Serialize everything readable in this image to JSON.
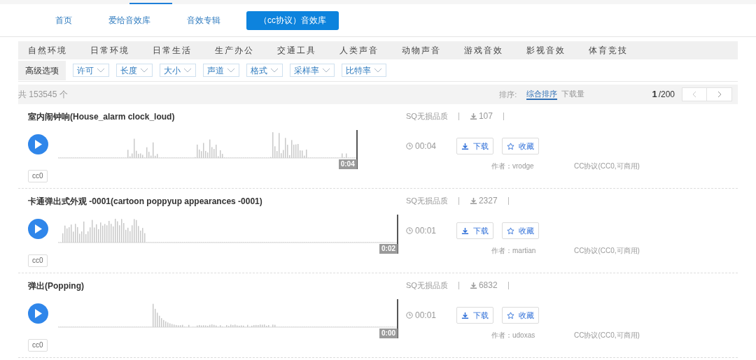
{
  "nav": [
    {
      "label": "首页",
      "selected": false
    },
    {
      "label": "爱给音效库",
      "selected": false
    },
    {
      "label": "音效专辑",
      "selected": false
    },
    {
      "label": "（cc协议）音效库",
      "selected": true
    }
  ],
  "categories": [
    "自然环境",
    "日常环境",
    "日常生活",
    "生产办公",
    "交通工具",
    "人类声音",
    "动物声音",
    "游戏音效",
    "影视音效",
    "体育竞技"
  ],
  "filters": {
    "label": "高级选项",
    "options": [
      "许可",
      "长度",
      "大小",
      "声道",
      "格式",
      "采样率",
      "比特率"
    ]
  },
  "results": {
    "count": "共 153545 个",
    "sort_label": "排序:",
    "sort_options": [
      {
        "label": "综合排序",
        "selected": true
      },
      {
        "label": "下载量",
        "selected": false
      }
    ],
    "page": "1",
    "total_pages": "/200"
  },
  "sounds": [
    {
      "title": "室内闹钟响(House_alarm clock_loud)",
      "time_badge": "0:04",
      "level": 0.88,
      "tag": "cc0",
      "quality": "SQ无损品质",
      "downloads": "107",
      "duration": "00:04",
      "download_button": "下载",
      "favorite_button": "收藏",
      "author": "作者：vrodge",
      "license": "CC协议(CC0,可商用)"
    },
    {
      "title": "卡通弹出式外观 -0001(cartoon poppyup appearances -0001)",
      "time_badge": "0:02",
      "level": 1,
      "tag": "cc0",
      "quality": "SQ无损品质",
      "downloads": "2327",
      "duration": "00:01",
      "download_button": "下载",
      "favorite_button": "收藏",
      "author": "作者：martian",
      "license": "CC协议(CC0,可商用)"
    },
    {
      "title": "弹出(Popping)",
      "time_badge": "0:00",
      "level": 1,
      "tag": "cc0",
      "quality": "SQ无损品质",
      "downloads": "6832",
      "duration": "00:01",
      "download_button": "下载",
      "favorite_button": "收藏",
      "author": "作者：udoxas",
      "license": "CC协议(CC0,可商用)"
    }
  ]
}
